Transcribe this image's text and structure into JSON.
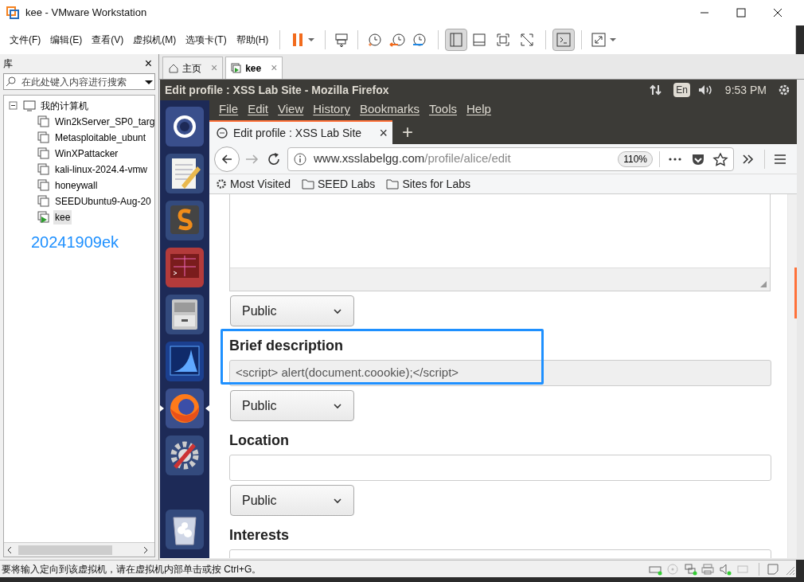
{
  "window": {
    "title": "kee - VMware Workstation"
  },
  "menu": [
    "文件(F)",
    "编辑(E)",
    "查看(V)",
    "虚拟机(M)",
    "选项卡(T)",
    "帮助(H)"
  ],
  "library": {
    "title": "库",
    "close": "×",
    "search_placeholder": "在此处键入内容进行搜索",
    "root": {
      "label": "我的计算机",
      "expanded": true,
      "children": [
        {
          "label": "Win2kServer_SP0_targ",
          "running": false,
          "selected": false
        },
        {
          "label": "Metasploitable_ubunt",
          "running": false,
          "selected": false
        },
        {
          "label": "WinXPattacker",
          "running": false,
          "selected": false
        },
        {
          "label": "kali-linux-2024.4-vmw",
          "running": false,
          "selected": false
        },
        {
          "label": "honeywall",
          "running": false,
          "selected": false
        },
        {
          "label": "SEEDUbuntu9-Aug-20",
          "running": false,
          "selected": false
        },
        {
          "label": "kee",
          "running": true,
          "selected": true
        }
      ]
    },
    "note": "20241909ek"
  },
  "tabs": [
    {
      "label": "主页",
      "kind": "home",
      "selected": false,
      "close": "×"
    },
    {
      "label": "kee",
      "kind": "vm",
      "selected": true,
      "close": "×"
    }
  ],
  "guest": {
    "top_bar": {
      "title": "Edit profile : XSS Lab Site - Mozilla Firefox",
      "lang": "En",
      "time": "9:53 PM"
    },
    "launcher": [
      {
        "kind": "ubuntu",
        "active": false
      },
      {
        "kind": "editor",
        "active": false
      },
      {
        "kind": "sublime",
        "active": false
      },
      {
        "kind": "terminal",
        "active": false
      },
      {
        "kind": "files",
        "active": false
      },
      {
        "kind": "wireshark",
        "active": false
      },
      {
        "kind": "firefox",
        "active": true
      },
      {
        "kind": "settings",
        "active": false
      },
      {
        "kind": "trash",
        "active": false
      }
    ],
    "firefox": {
      "menu": [
        "File",
        "Edit",
        "View",
        "History",
        "Bookmarks",
        "Tools",
        "Help"
      ],
      "tab": {
        "title": "Edit profile : XSS Lab Site",
        "close": "×"
      },
      "new_tab": "+",
      "url": {
        "host": "www.xsslabelgg.com",
        "path": "/profile/alice/edit"
      },
      "zoom": "110%",
      "bookmarks": [
        {
          "label": "Most Visited",
          "kind": "gear"
        },
        {
          "label": "SEED Labs",
          "kind": "folder"
        },
        {
          "label": "Sites for Labs",
          "kind": "folder"
        }
      ],
      "form": [
        {
          "kind": "textarea"
        },
        {
          "kind": "select",
          "value": "Public"
        },
        {
          "kind": "field",
          "label": "Brief description",
          "value": "<script> alert(document.coookie);</script>",
          "annotated": true
        },
        {
          "kind": "select",
          "value": "Public"
        },
        {
          "kind": "field",
          "label": "Location",
          "annotated": false
        },
        {
          "kind": "select",
          "value": "Public"
        },
        {
          "kind": "field",
          "label": "Interests",
          "annotated": false
        }
      ]
    }
  },
  "status_bar": {
    "text": "要将输入定向到该虚拟机，请在虚拟机内部单击或按 Ctrl+G。"
  }
}
